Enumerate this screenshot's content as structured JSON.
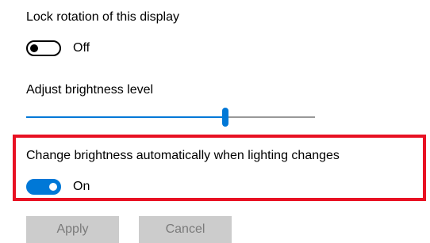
{
  "settings": {
    "lock_rotation": {
      "label": "Lock rotation of this display",
      "state_label": "Off",
      "is_on": false
    },
    "brightness": {
      "label": "Adjust brightness level",
      "level_fraction": 0.69
    },
    "auto_brightness": {
      "label": "Change brightness automatically when lighting changes",
      "state_label": "On",
      "is_on": true,
      "highlight_color": "#e81123"
    }
  },
  "actions": {
    "apply_label": "Apply",
    "cancel_label": "Cancel",
    "enabled": false
  },
  "colors": {
    "accent": "#0078d7",
    "track": "#999999",
    "disabled_button_bg": "#cccccc",
    "disabled_button_text": "#7a7a7a"
  }
}
